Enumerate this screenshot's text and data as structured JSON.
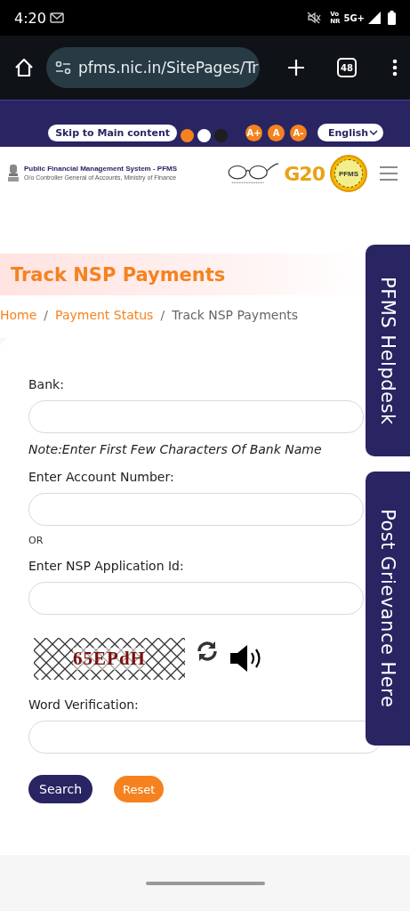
{
  "status_bar": {
    "time": "4:20",
    "volte_top": "Vo",
    "volte_bottom": "NR",
    "network": "5G+"
  },
  "browser": {
    "url": "pfms.nic.in/SitePages/Tr",
    "tab_count": "48"
  },
  "top_bar": {
    "skip_link": "Skip to Main content",
    "themes": [
      {
        "color": "#f5821f"
      },
      {
        "color": "#ffffff"
      },
      {
        "color": "#1e1e1e"
      }
    ],
    "font_sizes": [
      "A+",
      "A",
      "A-"
    ],
    "language": "English"
  },
  "header": {
    "org_name": "Public Financial Management System - PFMS",
    "org_sub": "O/o Controller General of Accounts, Ministry of Finance",
    "g20": "G20",
    "seal_text": "PFMS"
  },
  "page": {
    "title": "Track NSP Payments",
    "separator": "/",
    "breadcrumb": [
      {
        "label": "Home",
        "kind": "link"
      },
      {
        "label": "Payment Status",
        "kind": "link"
      },
      {
        "label": "Track NSP Payments",
        "kind": "current"
      }
    ]
  },
  "form": {
    "items": [
      {
        "kind": "field",
        "label": "Bank:"
      },
      {
        "kind": "note",
        "text": "Note:Enter First Few Characters Of Bank Name"
      },
      {
        "kind": "field",
        "label": "Enter Account Number:"
      },
      {
        "kind": "or",
        "text": "OR"
      },
      {
        "kind": "field",
        "label": "Enter NSP Application Id:"
      },
      {
        "kind": "captcha",
        "text": "65EPdH"
      },
      {
        "kind": "field",
        "label": "Word Verification:"
      }
    ],
    "buttons": [
      {
        "label": "Search",
        "kind": "primary"
      },
      {
        "label": "Reset",
        "kind": "secondary"
      }
    ]
  },
  "side_tabs": [
    "PFMS Helpdesk",
    "Post Grievance Here"
  ]
}
